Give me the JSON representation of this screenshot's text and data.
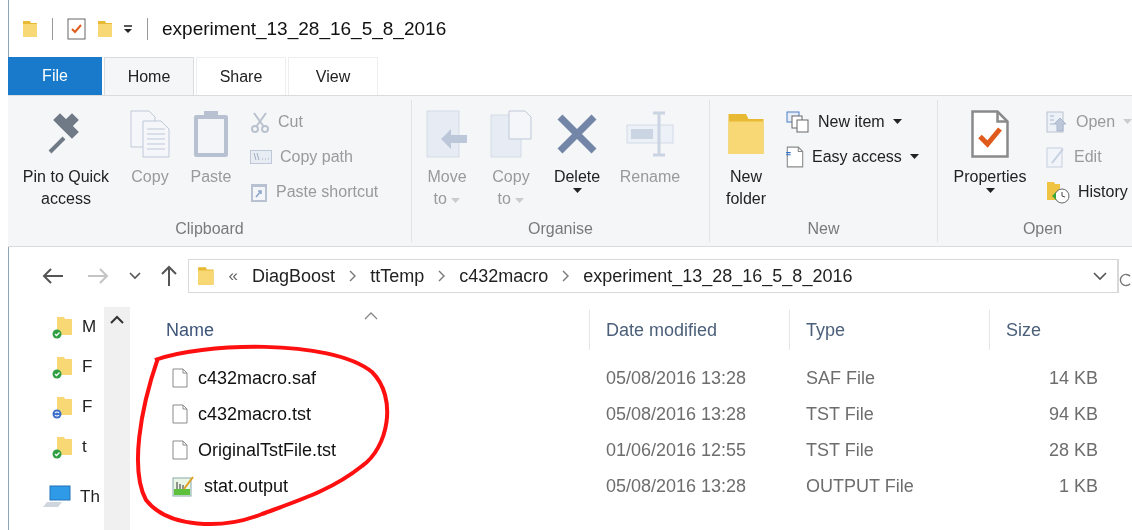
{
  "window": {
    "title": "experiment_13_28_16_5_8_2016"
  },
  "tabs": [
    {
      "label": "File",
      "kind": "file",
      "selected": false
    },
    {
      "label": "Home",
      "kind": "tab",
      "selected": true
    },
    {
      "label": "Share",
      "kind": "tab",
      "selected": false
    },
    {
      "label": "View",
      "kind": "tab",
      "selected": false
    }
  ],
  "ribbon": {
    "groups": [
      {
        "label": "Clipboard",
        "commands": [
          {
            "lines": [
              "Pin to Quick",
              "access"
            ],
            "kind": "large",
            "disabled": false,
            "dropdown": false
          },
          {
            "lines": [
              "Copy"
            ],
            "kind": "large",
            "disabled": true,
            "dropdown": false
          },
          {
            "lines": [
              "Paste"
            ],
            "kind": "large",
            "disabled": true,
            "dropdown": false
          },
          {
            "lines": [
              "Cut"
            ],
            "kind": "small",
            "disabled": true,
            "dropdown": false
          },
          {
            "lines": [
              "Copy path"
            ],
            "kind": "small",
            "disabled": true,
            "dropdown": false
          },
          {
            "lines": [
              "Paste shortcut"
            ],
            "kind": "small",
            "disabled": true,
            "dropdown": false
          }
        ]
      },
      {
        "label": "Organise",
        "commands": [
          {
            "lines": [
              "Move",
              "to"
            ],
            "kind": "large",
            "disabled": true,
            "dropdown": true
          },
          {
            "lines": [
              "Copy",
              "to"
            ],
            "kind": "large",
            "disabled": true,
            "dropdown": true
          },
          {
            "lines": [
              "Delete"
            ],
            "kind": "large",
            "disabled": false,
            "dropdown": true
          },
          {
            "lines": [
              "Rename"
            ],
            "kind": "large",
            "disabled": true,
            "dropdown": false
          }
        ]
      },
      {
        "label": "New",
        "commands": [
          {
            "lines": [
              "New",
              "folder"
            ],
            "kind": "large",
            "disabled": false,
            "dropdown": false
          },
          {
            "lines": [
              "New item"
            ],
            "kind": "small",
            "disabled": false,
            "dropdown": true
          },
          {
            "lines": [
              "Easy access"
            ],
            "kind": "small",
            "disabled": false,
            "dropdown": true
          }
        ]
      },
      {
        "label": "Open",
        "commands": [
          {
            "lines": [
              "Properties"
            ],
            "kind": "large",
            "disabled": false,
            "dropdown": true
          },
          {
            "lines": [
              "Open"
            ],
            "kind": "small",
            "disabled": true,
            "dropdown": true
          },
          {
            "lines": [
              "Edit"
            ],
            "kind": "small",
            "disabled": true,
            "dropdown": false
          },
          {
            "lines": [
              "History"
            ],
            "kind": "small",
            "disabled": false,
            "dropdown": false
          }
        ]
      }
    ]
  },
  "nav_buttons": [
    {
      "kind": "back",
      "disabled": false
    },
    {
      "kind": "forward",
      "disabled": true
    },
    {
      "kind": "recent",
      "disabled": false
    },
    {
      "kind": "up",
      "disabled": false
    }
  ],
  "address_bar": {
    "overflow": "«",
    "path": [
      "DiagBoost",
      "ttTemp",
      "c432macro",
      "experiment_13_28_16_5_8_2016"
    ]
  },
  "navigation": {
    "items": [
      {
        "label": "M",
        "kind": "synced"
      },
      {
        "label": "F",
        "kind": "synced"
      },
      {
        "label": "F",
        "kind": "syncing"
      },
      {
        "label": "t",
        "kind": "synced"
      },
      {
        "label": "Th",
        "kind": "computer"
      }
    ]
  },
  "file_list": {
    "columns": [
      {
        "label": "Name",
        "sorted": true
      },
      {
        "label": "Date modified",
        "sorted": false
      },
      {
        "label": "Type",
        "sorted": false
      },
      {
        "label": "Size",
        "sorted": false
      }
    ],
    "rows": [
      {
        "name": "c432macro.saf",
        "date_modified": "05/08/2016 13:28",
        "type": "SAF File",
        "size": "14 KB",
        "kind": "document"
      },
      {
        "name": "c432macro.tst",
        "date_modified": "05/08/2016 13:28",
        "type": "TST File",
        "size": "94 KB",
        "kind": "document"
      },
      {
        "name": "OriginalTstFile.tst",
        "date_modified": "01/06/2016 12:55",
        "type": "TST File",
        "size": "28 KB",
        "kind": "document"
      },
      {
        "name": "stat.output",
        "date_modified": "05/08/2016 13:28",
        "type": "OUTPUT File",
        "size": "1 KB",
        "kind": "output"
      }
    ]
  },
  "annotation": {
    "kind": "ellipse"
  }
}
